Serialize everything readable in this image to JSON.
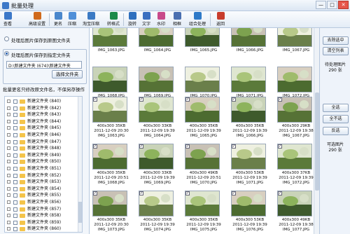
{
  "window": {
    "title": "批量处理",
    "buttons": [
      "—",
      "□",
      "✕"
    ]
  },
  "toolbar": [
    {
      "label": "查看",
      "icon": "view-grid-icon",
      "color": "#3c78c8"
    },
    {
      "label": "高级设置",
      "icon": "tools-icon",
      "color": "#d06a1c"
    },
    {
      "label": "更名",
      "icon": "rename-icon",
      "color": "#4a87cc"
    },
    {
      "label": "压缩",
      "icon": "compress-icon",
      "color": "#4f8fd8"
    },
    {
      "label": "淘宝压缩",
      "icon": "taobao-compress-icon",
      "color": "#3b7ac4"
    },
    {
      "label": "转格式",
      "icon": "convert-format-icon",
      "color": "#1c8a4a"
    },
    {
      "label": "旋转",
      "icon": "rotate-icon",
      "color": "#2e6fbe"
    },
    {
      "label": "文字",
      "icon": "text-icon",
      "color": "#3a6fc0"
    },
    {
      "label": "水印",
      "icon": "watermark-icon",
      "color": "#c84a8a"
    },
    {
      "label": "相框",
      "icon": "frame-icon",
      "color": "#4a6fb0"
    },
    {
      "label": "组合处理",
      "icon": "batch-combo-icon",
      "color": "#2f7ac8"
    },
    {
      "label": "返回",
      "icon": "back-icon",
      "color": "#c83c2c"
    }
  ],
  "left": {
    "radio1": "处理后图片保存到原图文件夹",
    "radio2": "处理后图片保存到指定文件夹",
    "path": "D:\\新建文件夹 (674)\\新建文件夹",
    "choose_folder": "选择文件夹",
    "note": "批量更名只修改原文件名，不保另存操作",
    "tree": [
      "新建文件夹 (840)",
      "新建文件夹 (842)",
      "新建文件夹 (843)",
      "新建文件夹 (844)",
      "新建文件夹 (845)",
      "新建文件夹 (846)",
      "新建文件夹 (847)",
      "新建文件夹 (848)",
      "新建文件夹 (849)",
      "新建文件夹 (850)",
      "新建文件夹 (851)",
      "新建文件夹 (852)",
      "新建文件夹 (853)",
      "新建文件夹 (854)",
      "新建文件夹 (855)",
      "新建文件夹 (856)",
      "新建文件夹 (857)",
      "新建文件夹 (858)",
      "新建文件夹 (859)",
      "新建文件夹 (860)"
    ]
  },
  "right": {
    "remove_selected": "去除选中",
    "clear_list": "清空列表",
    "pending_label": "待处理图片",
    "pending_count": "290 张",
    "select_all": "全选",
    "deselect_all": "全不选",
    "invert": "反选",
    "selectable_label": "可选图片",
    "selectable_count": "290 张"
  },
  "thumbnails": [
    {
      "row": 0,
      "name": "IMG_1063.JPG",
      "size": "",
      "date": "",
      "checked": false
    },
    {
      "row": 0,
      "name": "IMG_1064.JPG",
      "size": "",
      "date": "",
      "checked": false
    },
    {
      "row": 0,
      "name": "IMG_1065.JPG",
      "size": "",
      "date": "",
      "checked": false
    },
    {
      "row": 0,
      "name": "IMG_1066.JPG",
      "size": "",
      "date": "",
      "checked": false
    },
    {
      "row": 0,
      "name": "IMG_1067.JPG",
      "size": "",
      "date": "",
      "checked": false
    },
    {
      "row": 1,
      "name": "IMG_1068.JPG",
      "size": "",
      "date": "",
      "checked": false
    },
    {
      "row": 1,
      "name": "IMG_1069.JPG",
      "size": "",
      "date": "",
      "checked": false
    },
    {
      "row": 1,
      "name": "IMG_1070.JPG",
      "size": "",
      "date": "",
      "checked": false
    },
    {
      "row": 1,
      "name": "IMG_1071.JPG",
      "size": "",
      "date": "",
      "checked": false
    },
    {
      "row": 1,
      "name": "IMG_1072.JPG",
      "size": "",
      "date": "",
      "checked": false
    },
    {
      "row": 2,
      "name": "IMG_1063.JPG",
      "size": "400x300  35KB",
      "date": "2011-12-09 20:30",
      "checked": true
    },
    {
      "row": 2,
      "name": "IMG_1064.JPG",
      "size": "400x300  33KB",
      "date": "2011-12-09 19:39",
      "checked": true
    },
    {
      "row": 2,
      "name": "IMG_1065.JPG",
      "size": "400x300  35KB",
      "date": "2011-12-09 19:39",
      "checked": true
    },
    {
      "row": 2,
      "name": "IMG_1066.JPG",
      "size": "400x300  35KB",
      "date": "2011-12-09 19:39",
      "checked": true
    },
    {
      "row": 2,
      "name": "IMG_1067.JPG",
      "size": "400x300  29KB",
      "date": "2011-12-09 19:38",
      "checked": true
    },
    {
      "row": 3,
      "name": "IMG_1068.JPG",
      "size": "400x300  35KB",
      "date": "2011-12-09 20:51",
      "checked": true
    },
    {
      "row": 3,
      "name": "IMG_1069.JPG",
      "size": "400x300  33KB",
      "date": "2011-12-09 19:39",
      "checked": true
    },
    {
      "row": 3,
      "name": "IMG_1070.JPG",
      "size": "400x300  49KB",
      "date": "2011-12-09 20:51",
      "checked": true
    },
    {
      "row": 3,
      "name": "IMG_1071.JPG",
      "size": "400x300  53KB",
      "date": "2011-12-09 19:39",
      "checked": true
    },
    {
      "row": 3,
      "name": "IMG_1072.JPG",
      "size": "400x300  37KB",
      "date": "2011-12-09 19:39",
      "checked": true
    },
    {
      "row": 4,
      "name": "IMG_1073.JPG",
      "size": "400x300  35KB",
      "date": "2011-12-09 20:30",
      "checked": true
    },
    {
      "row": 4,
      "name": "IMG_1074.JPG",
      "size": "400x300  35KB",
      "date": "2011-12-09 19:39",
      "checked": true
    },
    {
      "row": 4,
      "name": "IMG_1075.JPG",
      "size": "400x300  35KB",
      "date": "2011-12-09 19:39",
      "checked": true
    },
    {
      "row": 4,
      "name": "IMG_1076.JPG",
      "size": "400x300  53KB",
      "date": "2011-12-09 19:39",
      "checked": true
    },
    {
      "row": 4,
      "name": "IMG_1077.JPG",
      "size": "400x300  49KB",
      "date": "2011-12-09 19:38",
      "checked": true
    }
  ]
}
